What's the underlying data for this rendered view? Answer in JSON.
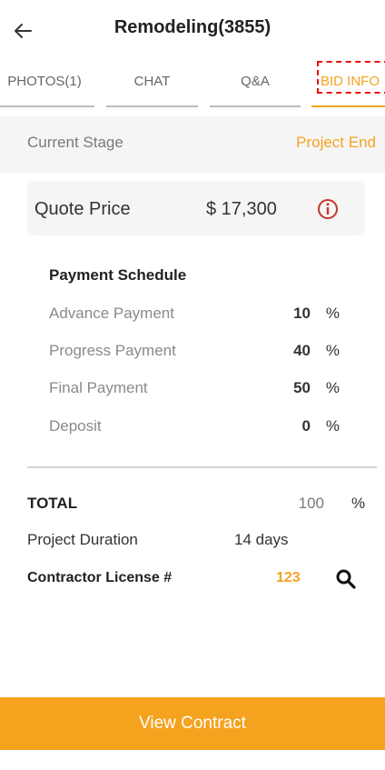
{
  "header": {
    "title": "Remodeling(3855)",
    "back_icon": "arrow-left-icon"
  },
  "tabs": [
    {
      "label": "PHOTOS(1)",
      "active": false
    },
    {
      "label": "CHAT",
      "active": false
    },
    {
      "label": "Q&A",
      "active": false
    },
    {
      "label": "BID INFO",
      "active": true
    }
  ],
  "stage": {
    "label": "Current Stage",
    "value": "Project End"
  },
  "quote": {
    "label": "Quote Price",
    "value": "$ 17,300",
    "info_icon": "info-icon"
  },
  "payment_schedule": {
    "title": "Payment Schedule",
    "rows": [
      {
        "label": "Advance Payment",
        "value": "10",
        "unit": "%"
      },
      {
        "label": "Progress Payment",
        "value": "40",
        "unit": "%"
      },
      {
        "label": "Final Payment",
        "value": "50",
        "unit": "%"
      },
      {
        "label": "Deposit",
        "value": "0",
        "unit": "%"
      }
    ]
  },
  "total": {
    "label": "TOTAL",
    "value": "100",
    "unit": "%"
  },
  "duration": {
    "label": "Project Duration",
    "value": "14 days"
  },
  "license": {
    "label": "Contractor License #",
    "value": "123",
    "search_icon": "search-icon"
  },
  "footer": {
    "button_label": "View Contract"
  },
  "colors": {
    "accent": "#f4a321",
    "button": "#f5a31e",
    "info": "#c0392b",
    "highlight": "#e8120c"
  }
}
